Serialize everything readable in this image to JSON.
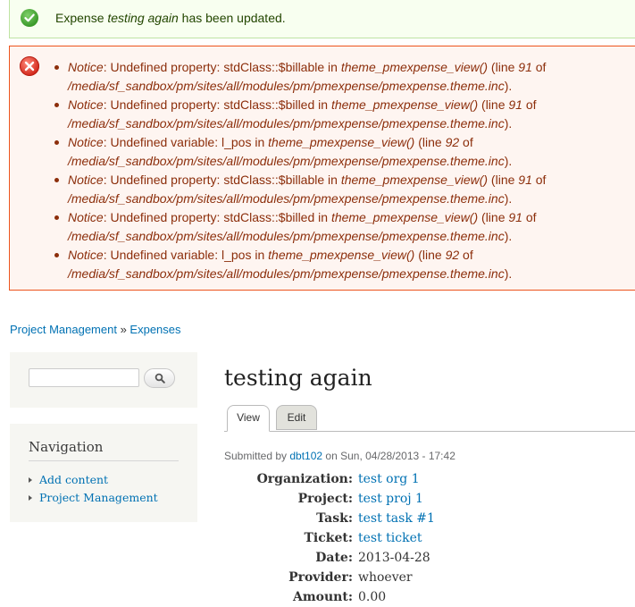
{
  "status_message": {
    "prefix": "Expense ",
    "title": "testing again",
    "suffix": " has been updated."
  },
  "errors": [
    {
      "type": "Notice",
      "message": ": Undefined property: stdClass::$billable in ",
      "func": "theme_pmexpense_view()",
      "mid": " (line ",
      "line": "91",
      "of": " of ",
      "path": "/media/sf_sandbox/pm/sites/all/modules/pm/pmexpense/pmexpense.theme.inc",
      "end": ")."
    },
    {
      "type": "Notice",
      "message": ": Undefined property: stdClass::$billed in ",
      "func": "theme_pmexpense_view()",
      "mid": " (line ",
      "line": "91",
      "of": " of ",
      "path": "/media/sf_sandbox/pm/sites/all/modules/pm/pmexpense/pmexpense.theme.inc",
      "end": ")."
    },
    {
      "type": "Notice",
      "message": ": Undefined variable: l_pos in ",
      "func": "theme_pmexpense_view()",
      "mid": " (line ",
      "line": "92",
      "of": " of ",
      "path": "/media/sf_sandbox/pm/sites/all/modules/pm/pmexpense/pmexpense.theme.inc",
      "end": ")."
    },
    {
      "type": "Notice",
      "message": ": Undefined property: stdClass::$billable in ",
      "func": "theme_pmexpense_view()",
      "mid": " (line ",
      "line": "91",
      "of": " of ",
      "path": "/media/sf_sandbox/pm/sites/all/modules/pm/pmexpense/pmexpense.theme.inc",
      "end": ")."
    },
    {
      "type": "Notice",
      "message": ": Undefined property: stdClass::$billed in ",
      "func": "theme_pmexpense_view()",
      "mid": " (line ",
      "line": "91",
      "of": " of ",
      "path": "/media/sf_sandbox/pm/sites/all/modules/pm/pmexpense/pmexpense.theme.inc",
      "end": ")."
    },
    {
      "type": "Notice",
      "message": ": Undefined variable: l_pos in ",
      "func": "theme_pmexpense_view()",
      "mid": " (line ",
      "line": "92",
      "of": " of ",
      "path": "/media/sf_sandbox/pm/sites/all/modules/pm/pmexpense/pmexpense.theme.inc",
      "end": ")."
    }
  ],
  "breadcrumb": {
    "items": [
      "Project Management",
      "Expenses"
    ],
    "separator": " » "
  },
  "search": {
    "placeholder": ""
  },
  "navigation": {
    "title": "Navigation",
    "items": [
      "Add content",
      "Project Management"
    ]
  },
  "page": {
    "title": "testing again",
    "tabs": [
      "View",
      "Edit"
    ],
    "submitted_prefix": "Submitted by ",
    "author": "dbt102",
    "submitted_suffix": " on Sun, 04/28/2013 - 17:42"
  },
  "fields": [
    {
      "label": "Organization:",
      "value": "test org 1",
      "link": true
    },
    {
      "label": "Project:",
      "value": "test proj 1",
      "link": true
    },
    {
      "label": "Task:",
      "value": "test task #1",
      "link": true
    },
    {
      "label": "Ticket:",
      "value": "test ticket",
      "link": true
    },
    {
      "label": "Date:",
      "value": "2013-04-28",
      "link": false
    },
    {
      "label": "Provider:",
      "value": "whoever",
      "link": false
    },
    {
      "label": "Amount:",
      "value": "0.00",
      "link": false
    }
  ],
  "icons": {
    "status": "checkmark-icon",
    "error": "error-x-icon",
    "search": "magnifier-icon"
  },
  "colors": {
    "link": "#0071b3",
    "error_text": "#8c2e0b",
    "error_border": "#ed541d",
    "status_border": "#bee3a3"
  }
}
